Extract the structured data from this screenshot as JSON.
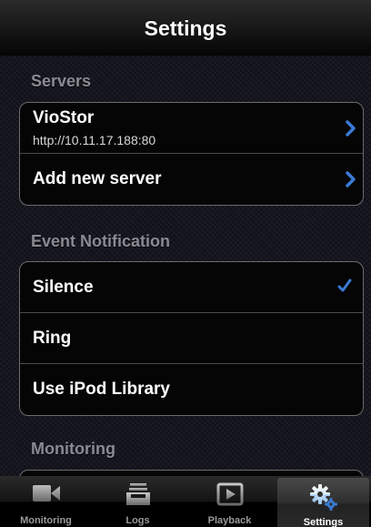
{
  "navbar": {
    "title": "Settings"
  },
  "sections": {
    "servers": {
      "header": "Servers",
      "items": [
        {
          "label": "VioStor",
          "subtitle": "http://10.11.17.188:80"
        },
        {
          "label": "Add new server"
        }
      ]
    },
    "event_notification": {
      "header": "Event Notification",
      "items": [
        {
          "label": "Silence",
          "selected": true
        },
        {
          "label": "Ring",
          "selected": false
        },
        {
          "label": "Use iPod Library",
          "selected": false
        }
      ]
    },
    "monitoring": {
      "header": "Monitoring"
    }
  },
  "tabbar": {
    "tabs": [
      {
        "label": "Monitoring",
        "icon": "video-camera-icon",
        "active": false
      },
      {
        "label": "Logs",
        "icon": "inbox-tray-icon",
        "active": false
      },
      {
        "label": "Playback",
        "icon": "play-icon",
        "active": false
      },
      {
        "label": "Settings",
        "icon": "gears-icon",
        "active": true
      }
    ]
  },
  "colors": {
    "accent_blue": "#3a7bd5",
    "section_header": "#8a8a94",
    "cell_background": "#050505"
  }
}
